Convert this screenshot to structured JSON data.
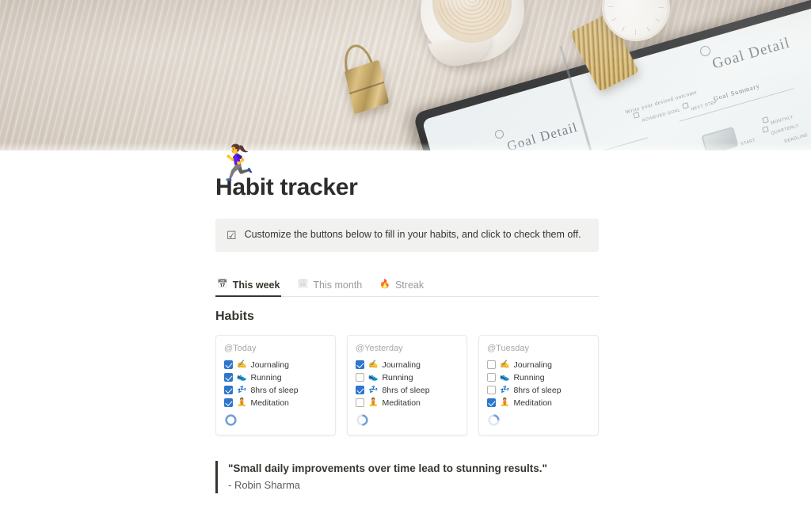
{
  "hero": {
    "alt": "wooden desk with coffee cup, gold watch, binder clip and open goal planner notebook",
    "notebook_heading_1": "Goal Detail",
    "notebook_heading_2": "Goal Detail",
    "notebook_sub_1": "Goal Summary",
    "notebook_sub_2": "Write your desired outcome",
    "notebook_checkbox_labels": [
      "ACHIEVED GOAL",
      "NEXT STEP",
      "MONTHLY",
      "QUARTERLY",
      "START",
      "DEADLINE"
    ]
  },
  "page": {
    "icon": "🏃‍♀️",
    "icon_name": "running-person-emoji",
    "title": "Habit tracker"
  },
  "callout": {
    "icon": "☑",
    "icon_name": "checked-box-icon",
    "text": "Customize the buttons below to fill in your habits, and click to check them off."
  },
  "tabs": [
    {
      "label": "This week",
      "icon": "📅",
      "icon_name": "calendar-week-icon",
      "active": true
    },
    {
      "label": "This month",
      "icon": "🗓",
      "icon_name": "calendar-month-icon",
      "active": false
    },
    {
      "label": "Streak",
      "icon": "🔥",
      "icon_name": "fire-icon",
      "active": false
    }
  ],
  "habits_section": {
    "title": "Habits",
    "cards": [
      {
        "title": "@Today",
        "progress_pct": 100,
        "habits": [
          {
            "emoji": "✍️",
            "emoji_name": "writing-hand-emoji",
            "label": "Journaling",
            "checked": true
          },
          {
            "emoji": "👟",
            "emoji_name": "running-shoe-emoji",
            "label": "Running",
            "checked": true
          },
          {
            "emoji": "💤",
            "emoji_name": "sleep-zzz-emoji",
            "label": "8hrs of sleep",
            "checked": true
          },
          {
            "emoji": "🧘",
            "emoji_name": "meditation-emoji",
            "label": "Meditation",
            "checked": true
          }
        ]
      },
      {
        "title": "@Yesterday",
        "progress_pct": 50,
        "habits": [
          {
            "emoji": "✍️",
            "emoji_name": "writing-hand-emoji",
            "label": "Journaling",
            "checked": true
          },
          {
            "emoji": "👟",
            "emoji_name": "running-shoe-emoji",
            "label": "Running",
            "checked": false
          },
          {
            "emoji": "💤",
            "emoji_name": "sleep-zzz-emoji",
            "label": "8hrs of sleep",
            "checked": true
          },
          {
            "emoji": "🧘",
            "emoji_name": "meditation-emoji",
            "label": "Meditation",
            "checked": false
          }
        ]
      },
      {
        "title": "@Tuesday",
        "progress_pct": 25,
        "habits": [
          {
            "emoji": "✍️",
            "emoji_name": "writing-hand-emoji",
            "label": "Journaling",
            "checked": false
          },
          {
            "emoji": "👟",
            "emoji_name": "running-shoe-emoji",
            "label": "Running",
            "checked": false
          },
          {
            "emoji": "💤",
            "emoji_name": "sleep-zzz-emoji",
            "label": "8hrs of sleep",
            "checked": false
          },
          {
            "emoji": "🧘",
            "emoji_name": "meditation-emoji",
            "label": "Meditation",
            "checked": true
          }
        ]
      }
    ]
  },
  "quote": {
    "text": "\"Small daily improvements over time lead to stunning results.\"",
    "author": "- Robin Sharma"
  },
  "colors": {
    "checkbox_checked": "#2e75cc",
    "checkbox_border": "#b4b2ad",
    "text_primary": "#37352f",
    "text_muted": "#9b9a97",
    "callout_bg": "#f1f1ef",
    "card_border": "#eceae6",
    "progress_track": "#dfe7f2",
    "progress_fill": "#6f9fd8"
  }
}
